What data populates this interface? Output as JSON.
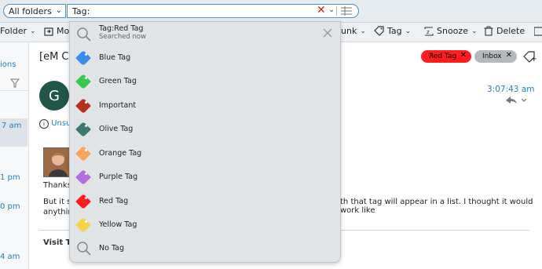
{
  "topbar": {
    "folder": "All folders",
    "search_value": "Tag:"
  },
  "toolbar": {
    "items": [
      "Folder",
      "Mo",
      "unk",
      "Tag",
      "Snooze",
      "Delete"
    ]
  },
  "left": {
    "ions": "ions",
    "t1": "7 am",
    "t2": "1 pm",
    "t3": "0 pm",
    "t4": "4 am"
  },
  "main": {
    "subject": "[eM Cli",
    "unsub": "Unsu",
    "avatar_letter": "G",
    "time": "3:07:43 am",
    "chips": [
      {
        "label": "Red Tag",
        "color": "#ff1d1d"
      },
      {
        "label": "Inbox",
        "color": "#b6b9bc"
      }
    ],
    "thanks": "Thanks,",
    "body_left_1": "But it so",
    "body_left_2": "anything",
    "body_right": "th that tag will appear in a list. I thought it would work like",
    "visit": "Visit To"
  },
  "dropdown": {
    "recent": {
      "title": "Tag:Red Tag",
      "subtitle": "Searched now"
    },
    "tags": [
      {
        "label": "Blue Tag",
        "color": "#3a8df0"
      },
      {
        "label": "Green Tag",
        "color": "#38c94c"
      },
      {
        "label": "Important",
        "color": "#b6311c"
      },
      {
        "label": "Olive Tag",
        "color": "#3b7a73"
      },
      {
        "label": "Orange Tag",
        "color": "#f7a65a"
      },
      {
        "label": "Purple Tag",
        "color": "#b66be2"
      },
      {
        "label": "Red Tag",
        "color": "#ff1d1d"
      },
      {
        "label": "Yellow Tag",
        "color": "#f7d34a"
      }
    ],
    "no_tag": "No Tag"
  }
}
